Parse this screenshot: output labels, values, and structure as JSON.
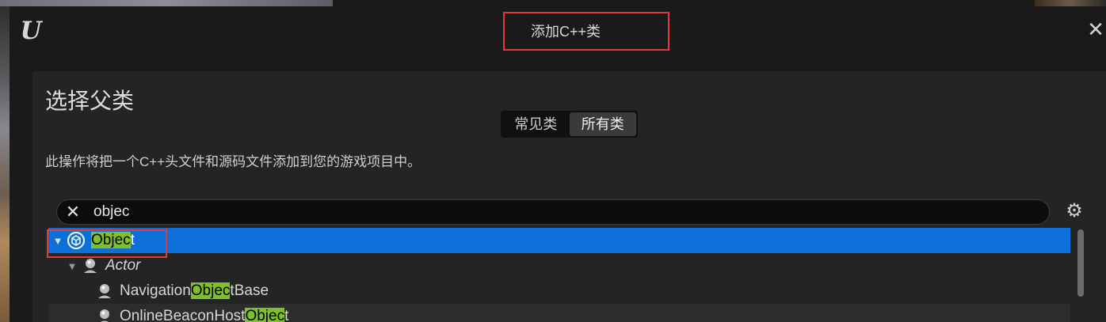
{
  "window": {
    "title": "添加C++类",
    "close_label": "✕",
    "logo_text": "U"
  },
  "header": {
    "heading": "选择父类",
    "description": "此操作将把一个C++头文件和源码文件添加到您的游戏项目中。"
  },
  "tabs": [
    {
      "label": "常见类",
      "active": false
    },
    {
      "label": "所有类",
      "active": true
    }
  ],
  "search": {
    "value": "objec",
    "clear_icon": "close-icon",
    "settings_icon": "gear-icon"
  },
  "tree": {
    "rows": [
      {
        "pre": "",
        "match": "Objec",
        "post": "t",
        "expanded": true,
        "selected": true
      },
      {
        "pre": "Actor",
        "match": "",
        "post": "",
        "expanded": true,
        "selected": false,
        "italic": true
      },
      {
        "pre": "Navigation",
        "match": "Objec",
        "post": "tBase",
        "selected": false
      },
      {
        "pre": "OnlineBeaconHost",
        "match": "Objec",
        "post": "t",
        "selected": false
      }
    ]
  },
  "colors": {
    "selection": "#0c70d8",
    "match_highlight": "#7ec02c",
    "annotation_box": "#e03a3a"
  }
}
